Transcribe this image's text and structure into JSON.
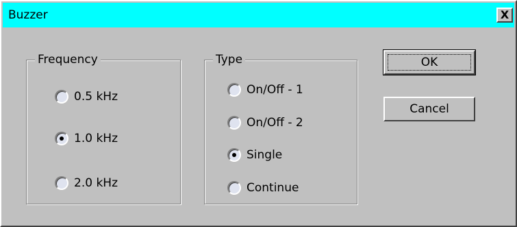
{
  "window": {
    "title": "Buzzer",
    "close_label": "X",
    "titlebar_color": "#00ffff",
    "face_color": "#c0c0c0"
  },
  "frequency": {
    "label": "Frequency",
    "options": [
      "0.5 kHz",
      "1.0 kHz",
      "2.0 kHz"
    ],
    "selected": "1.0 kHz"
  },
  "type": {
    "label": "Type",
    "options": [
      "On/Off - 1",
      "On/Off - 2",
      "Single",
      "Continue"
    ],
    "selected": "Single"
  },
  "buttons": {
    "ok_label": "OK",
    "cancel_label": "Cancel"
  }
}
